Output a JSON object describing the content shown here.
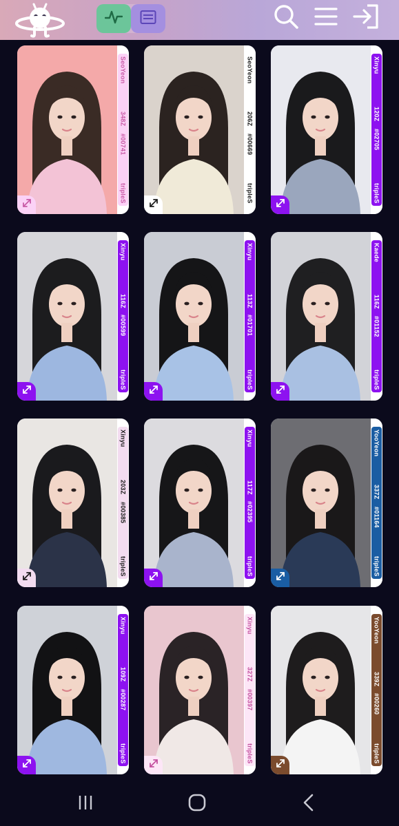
{
  "header": {
    "logo_icon": "alien-planet-logo",
    "toggles": [
      {
        "name": "activity-icon",
        "color": "#6cc59a"
      },
      {
        "name": "list-view-icon",
        "color": "#a48fe0"
      }
    ],
    "actions": [
      "search-icon",
      "menu-icon",
      "sign-in-icon"
    ]
  },
  "objekts": [
    {
      "member": "SeoYeon",
      "season": "348Z",
      "serial": "#00741",
      "group": "tripleS",
      "accent": "#fbd2f6",
      "text": "#c95aa6",
      "bg": "#f4a9a9",
      "hair": "#3a2b25",
      "top": "#f3c3d6"
    },
    {
      "member": "SeoYeon",
      "season": "206Z",
      "serial": "#00669",
      "group": "tripleS",
      "accent": "#ffffff",
      "text": "#1d1d1d",
      "bg": "#dad3cc",
      "hair": "#2b2320",
      "top": "#f0ead8"
    },
    {
      "member": "Xinyu",
      "season": "120Z",
      "serial": "#02705",
      "group": "tripleS",
      "accent": "#8d12f0",
      "text": "#ffffff",
      "bg": "#e8e9ef",
      "hair": "#1a1a1c",
      "top": "#9aa6bd"
    },
    {
      "member": "Xinyu",
      "season": "116Z",
      "serial": "#00599",
      "group": "tripleS",
      "accent": "#8d12f0",
      "text": "#ffffff",
      "bg": "#d6d6da",
      "hair": "#1c1c1e",
      "top": "#9db7e0"
    },
    {
      "member": "Xinyu",
      "season": "113Z",
      "serial": "#01701",
      "group": "tripleS",
      "accent": "#8d12f0",
      "text": "#ffffff",
      "bg": "#c9ccd4",
      "hair": "#151517",
      "top": "#a8c2e6"
    },
    {
      "member": "Kaede",
      "season": "116Z",
      "serial": "#01152",
      "group": "tripleS",
      "accent": "#8d12f0",
      "text": "#ffffff",
      "bg": "#d2d3d8",
      "hair": "#1f1f21",
      "top": "#a9c0e2"
    },
    {
      "member": "Xinyu",
      "season": "203Z",
      "serial": "#00385",
      "group": "tripleS",
      "accent": "#f3dcf0",
      "text": "#1d1d1d",
      "bg": "#e9e6e3",
      "hair": "#1a1a1d",
      "top": "#2b3348"
    },
    {
      "member": "Xinyu",
      "season": "117Z",
      "serial": "#02395",
      "group": "tripleS",
      "accent": "#8d12f0",
      "text": "#ffffff",
      "bg": "#dcdbdf",
      "hair": "#161618",
      "top": "#a9b4cc"
    },
    {
      "member": "YooYeon",
      "season": "337Z",
      "serial": "#01164",
      "group": "tripleS",
      "accent": "#1a5da3",
      "text": "#ffffff",
      "bg": "#6d6d72",
      "hair": "#1a1819",
      "top": "#2a3a57"
    },
    {
      "member": "Xinyu",
      "season": "109Z",
      "serial": "#00287",
      "group": "tripleS",
      "accent": "#8d12f0",
      "text": "#ffffff",
      "bg": "#cfd2d8",
      "hair": "#121214",
      "top": "#9fb8e0"
    },
    {
      "member": "Xinyu",
      "season": "327Z",
      "serial": "#00397",
      "group": "tripleS",
      "accent": "#fde6f7",
      "text": "#c44f9f",
      "bg": "#e9c6cf",
      "hair": "#2a2326",
      "top": "#f0e8e6"
    },
    {
      "member": "YooYeon",
      "season": "339Z",
      "serial": "#00260",
      "group": "tripleS",
      "accent": "#7b4b2d",
      "text": "#ffffff",
      "bg": "#e6e6e8",
      "hair": "#1e1c1d",
      "top": "#f4f4f4"
    }
  ],
  "navbar": [
    "recent-apps-icon",
    "home-icon",
    "back-icon"
  ]
}
